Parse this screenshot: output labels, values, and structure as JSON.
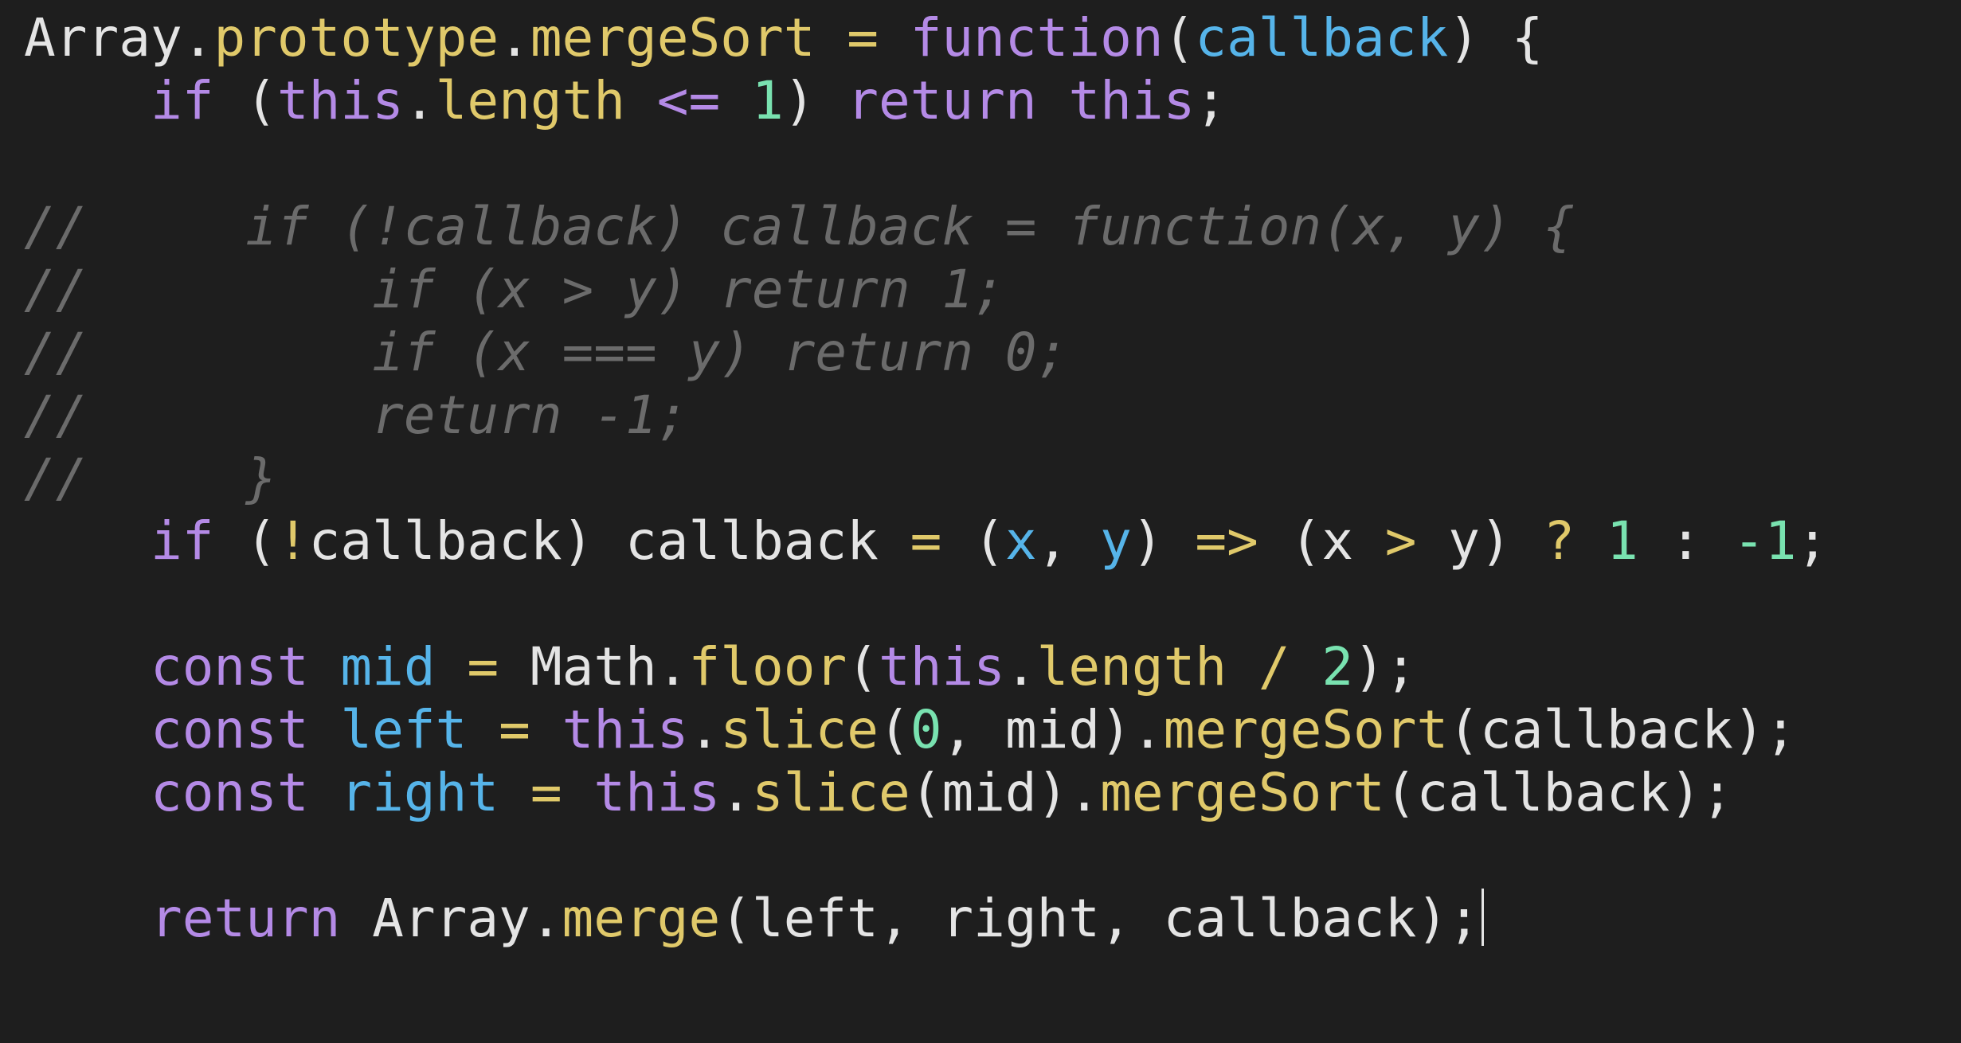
{
  "editor": {
    "theme_colors": {
      "background": "#1e1e1e",
      "plain": "#e4e4e4",
      "keyword": "#b48ae6",
      "function": "#e0c96a",
      "parameter": "#56b4e9",
      "number": "#79e2b0",
      "comment": "#6b6b6b"
    },
    "lines": [
      {
        "tokens": [
          {
            "t": "Array",
            "c": "plain"
          },
          {
            "t": ".",
            "c": "plain"
          },
          {
            "t": "prototype",
            "c": "fn"
          },
          {
            "t": ".",
            "c": "plain"
          },
          {
            "t": "mergeSort",
            "c": "fn"
          },
          {
            "t": " ",
            "c": "plain"
          },
          {
            "t": "=",
            "c": "op"
          },
          {
            "t": " ",
            "c": "plain"
          },
          {
            "t": "function",
            "c": "kw"
          },
          {
            "t": "(",
            "c": "plain"
          },
          {
            "t": "callback",
            "c": "param"
          },
          {
            "t": ") {",
            "c": "plain"
          }
        ]
      },
      {
        "tokens": [
          {
            "t": "    ",
            "c": "plain"
          },
          {
            "t": "if",
            "c": "kw"
          },
          {
            "t": " (",
            "c": "plain"
          },
          {
            "t": "this",
            "c": "kw"
          },
          {
            "t": ".",
            "c": "plain"
          },
          {
            "t": "length",
            "c": "fn"
          },
          {
            "t": " ",
            "c": "plain"
          },
          {
            "t": "<=",
            "c": "kw"
          },
          {
            "t": " ",
            "c": "plain"
          },
          {
            "t": "1",
            "c": "num"
          },
          {
            "t": ") ",
            "c": "plain"
          },
          {
            "t": "return",
            "c": "kw"
          },
          {
            "t": " ",
            "c": "plain"
          },
          {
            "t": "this",
            "c": "kw"
          },
          {
            "t": ";",
            "c": "plain"
          }
        ]
      },
      {
        "tokens": []
      },
      {
        "tokens": [
          {
            "t": "//     if (!callback) callback = function(x, y) {",
            "c": "cm"
          }
        ]
      },
      {
        "tokens": [
          {
            "t": "//         if (x > y) return 1;",
            "c": "cm"
          }
        ]
      },
      {
        "tokens": [
          {
            "t": "//         if (x === y) return 0;",
            "c": "cm"
          }
        ]
      },
      {
        "tokens": [
          {
            "t": "//         return -1;",
            "c": "cm"
          }
        ]
      },
      {
        "tokens": [
          {
            "t": "//     }",
            "c": "cm"
          }
        ]
      },
      {
        "tokens": [
          {
            "t": "    ",
            "c": "plain"
          },
          {
            "t": "if",
            "c": "kw"
          },
          {
            "t": " (",
            "c": "plain"
          },
          {
            "t": "!",
            "c": "op"
          },
          {
            "t": "callback) callback ",
            "c": "plain"
          },
          {
            "t": "=",
            "c": "op"
          },
          {
            "t": " (",
            "c": "plain"
          },
          {
            "t": "x",
            "c": "param"
          },
          {
            "t": ", ",
            "c": "plain"
          },
          {
            "t": "y",
            "c": "param"
          },
          {
            "t": ") ",
            "c": "plain"
          },
          {
            "t": "=>",
            "c": "op"
          },
          {
            "t": " (x ",
            "c": "plain"
          },
          {
            "t": ">",
            "c": "op"
          },
          {
            "t": " y) ",
            "c": "plain"
          },
          {
            "t": "?",
            "c": "op"
          },
          {
            "t": " ",
            "c": "plain"
          },
          {
            "t": "1",
            "c": "num"
          },
          {
            "t": " : ",
            "c": "plain"
          },
          {
            "t": "-1",
            "c": "num"
          },
          {
            "t": ";",
            "c": "plain"
          }
        ]
      },
      {
        "tokens": []
      },
      {
        "tokens": [
          {
            "t": "    ",
            "c": "plain"
          },
          {
            "t": "const",
            "c": "kw"
          },
          {
            "t": " ",
            "c": "plain"
          },
          {
            "t": "mid",
            "c": "param"
          },
          {
            "t": " ",
            "c": "plain"
          },
          {
            "t": "=",
            "c": "op"
          },
          {
            "t": " Math.",
            "c": "plain"
          },
          {
            "t": "floor",
            "c": "fn"
          },
          {
            "t": "(",
            "c": "plain"
          },
          {
            "t": "this",
            "c": "kw"
          },
          {
            "t": ".",
            "c": "plain"
          },
          {
            "t": "length",
            "c": "fn"
          },
          {
            "t": " ",
            "c": "plain"
          },
          {
            "t": "/",
            "c": "op"
          },
          {
            "t": " ",
            "c": "plain"
          },
          {
            "t": "2",
            "c": "num"
          },
          {
            "t": ");",
            "c": "plain"
          }
        ]
      },
      {
        "tokens": [
          {
            "t": "    ",
            "c": "plain"
          },
          {
            "t": "const",
            "c": "kw"
          },
          {
            "t": " ",
            "c": "plain"
          },
          {
            "t": "left",
            "c": "param"
          },
          {
            "t": " ",
            "c": "plain"
          },
          {
            "t": "=",
            "c": "op"
          },
          {
            "t": " ",
            "c": "plain"
          },
          {
            "t": "this",
            "c": "kw"
          },
          {
            "t": ".",
            "c": "plain"
          },
          {
            "t": "slice",
            "c": "fn"
          },
          {
            "t": "(",
            "c": "plain"
          },
          {
            "t": "0",
            "c": "num"
          },
          {
            "t": ", mid).",
            "c": "plain"
          },
          {
            "t": "mergeSort",
            "c": "fn"
          },
          {
            "t": "(callback);",
            "c": "plain"
          }
        ]
      },
      {
        "tokens": [
          {
            "t": "    ",
            "c": "plain"
          },
          {
            "t": "const",
            "c": "kw"
          },
          {
            "t": " ",
            "c": "plain"
          },
          {
            "t": "right",
            "c": "param"
          },
          {
            "t": " ",
            "c": "plain"
          },
          {
            "t": "=",
            "c": "op"
          },
          {
            "t": " ",
            "c": "plain"
          },
          {
            "t": "this",
            "c": "kw"
          },
          {
            "t": ".",
            "c": "plain"
          },
          {
            "t": "slice",
            "c": "fn"
          },
          {
            "t": "(mid).",
            "c": "plain"
          },
          {
            "t": "mergeSort",
            "c": "fn"
          },
          {
            "t": "(callback);",
            "c": "plain"
          }
        ]
      },
      {
        "tokens": []
      },
      {
        "tokens": [
          {
            "t": "    ",
            "c": "plain"
          },
          {
            "t": "return",
            "c": "kw"
          },
          {
            "t": " Array.",
            "c": "plain"
          },
          {
            "t": "merge",
            "c": "fn"
          },
          {
            "t": "(left, right, callback);",
            "c": "plain"
          }
        ],
        "cursor": true
      }
    ]
  }
}
